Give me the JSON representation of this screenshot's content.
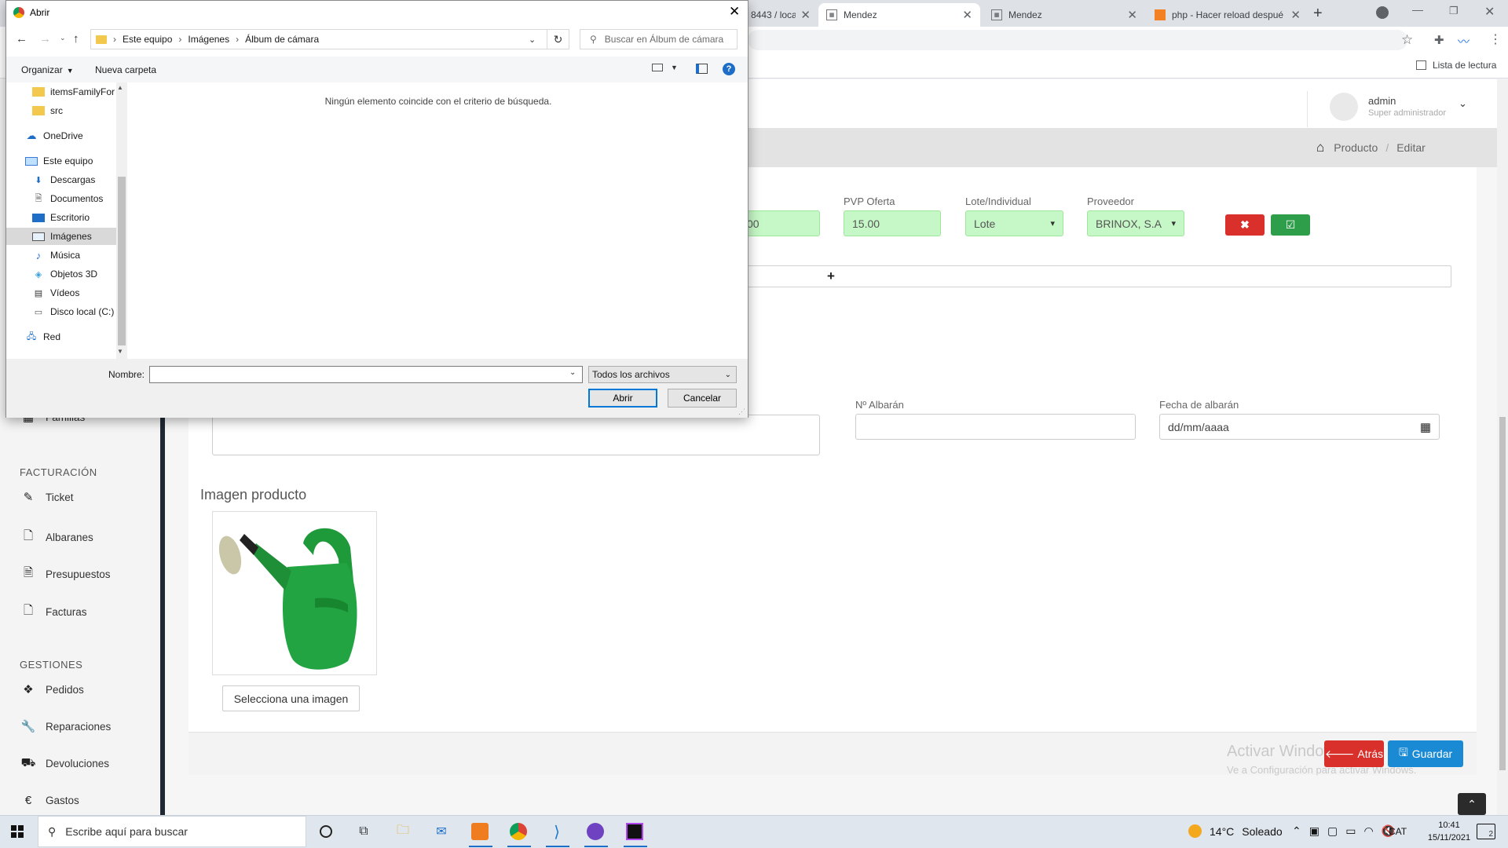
{
  "browser": {
    "tabs": [
      {
        "title": "8443 / loca"
      },
      {
        "title": "Mendez"
      },
      {
        "title": "Mendez"
      },
      {
        "title": "php - Hacer reload despué"
      }
    ],
    "reading_list": "Lista de lectura"
  },
  "header": {
    "user_name": "admin",
    "user_role": "Super administrador"
  },
  "breadcrumb": {
    "item1": "Producto",
    "sep": "/",
    "item2": "Editar"
  },
  "sidebar": {
    "partial_item": "Familias",
    "sections": [
      {
        "title": "FACTURACIÓN",
        "items": [
          {
            "label": "Ticket",
            "icon": "ticket-icon"
          },
          {
            "label": "Albaranes",
            "icon": "file-icon"
          },
          {
            "label": "Presupuestos",
            "icon": "file-icon"
          },
          {
            "label": "Facturas",
            "icon": "file-icon"
          }
        ]
      },
      {
        "title": "GESTIONES",
        "items": [
          {
            "label": "Pedidos",
            "icon": "dropbox-icon"
          },
          {
            "label": "Reparaciones",
            "icon": "wrench-icon"
          },
          {
            "label": "Devoluciones",
            "icon": "truck-icon"
          },
          {
            "label": "Gastos",
            "icon": "euro-icon"
          }
        ]
      }
    ]
  },
  "form": {
    "price_partial": "00",
    "pvp_oferta_label": "PVP Oferta",
    "pvp_oferta_value": "15.00",
    "lote_label": "Lote/Individual",
    "lote_value": "Lote",
    "proveedor_label": "Proveedor",
    "proveedor_value": "BRINOX, S.A",
    "add_row_symbol": "+",
    "albaran_label": "Nº Albarán",
    "albaran_value": "",
    "fecha_label": "Fecha de albarán",
    "fecha_placeholder": "dd/mm/aaaa",
    "image_section_title": "Imagen producto",
    "select_image_button": "Selecciona una imagen",
    "back_button": "Atrás",
    "save_button": "Guardar"
  },
  "watermark": {
    "line1": "Activar Windows",
    "line2": "Ve a Configuración para activar Windows."
  },
  "dialog": {
    "title": "Abrir",
    "path": [
      "Este equipo",
      "Imágenes",
      "Álbum de cámara"
    ],
    "search_placeholder": "Buscar en Álbum de cámara",
    "organize": "Organizar",
    "new_folder": "Nueva carpeta",
    "empty_message": "Ningún elemento coincide con el criterio de búsqueda.",
    "nav_items": [
      {
        "label": "itemsFamilyForr",
        "icon": "folder-icon"
      },
      {
        "label": "src",
        "icon": "folder-icon"
      },
      {
        "label": "OneDrive",
        "icon": "cloud-icon"
      },
      {
        "label": "Este equipo",
        "icon": "computer-icon"
      },
      {
        "label": "Descargas",
        "icon": "download-icon"
      },
      {
        "label": "Documentos",
        "icon": "document-icon"
      },
      {
        "label": "Escritorio",
        "icon": "desktop-icon"
      },
      {
        "label": "Imágenes",
        "icon": "pictures-icon"
      },
      {
        "label": "Música",
        "icon": "music-icon"
      },
      {
        "label": "Objetos 3D",
        "icon": "cube-icon"
      },
      {
        "label": "Vídeos",
        "icon": "video-icon"
      },
      {
        "label": "Disco local (C:)",
        "icon": "drive-icon"
      },
      {
        "label": "Red",
        "icon": "network-icon"
      }
    ],
    "filename_label": "Nombre:",
    "filename_value": "",
    "filetype_value": "Todos los archivos",
    "open_button": "Abrir",
    "cancel_button": "Cancelar"
  },
  "taskbar": {
    "search_placeholder": "Escribe aquí para buscar",
    "weather_temp": "14°C",
    "weather_text": "Soleado",
    "language": "CAT",
    "time": "10:41",
    "date": "15/11/2021",
    "notifications": "2"
  },
  "colors": {
    "danger": "#d9302c",
    "success": "#2e9e4a",
    "primary": "#1a8ad4",
    "sidebar_border": "#1f2933",
    "dialog_accent": "#0078d7"
  }
}
